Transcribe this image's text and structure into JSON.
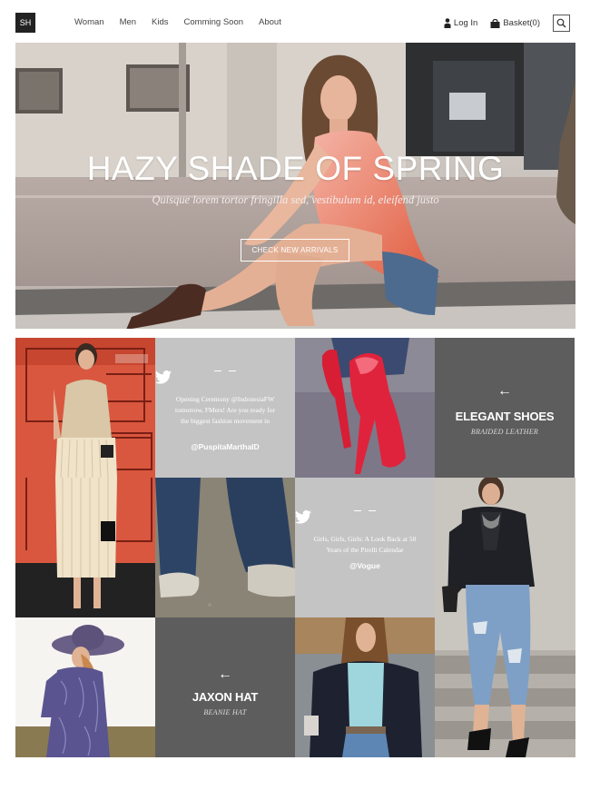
{
  "header": {
    "logo": "SH",
    "nav": [
      "Woman",
      "Men",
      "Kids",
      "Comming Soon",
      "About"
    ],
    "login_label": "Log In",
    "basket_label": "Basket(0)"
  },
  "hero": {
    "title": "HAZY SHADE OF SPRING",
    "subtitle": "Quisque lorem tortor fringilla sed, vestibulum id, eleifend justo",
    "button_label": "CHECK NEW ARRIVALS"
  },
  "tiles": {
    "tweet1": {
      "text": "Opening Ceremony @IndonesiaFW tomorrow, FMers! Are you ready for the biggest fashion movement in",
      "handle": "@PuspitaMarthaID"
    },
    "promo1": {
      "title": "ELEGANT SHOES",
      "subtitle": "BRAIDED LEATHER"
    },
    "tweet2": {
      "text": "Girls, Girls, Girls: A Look Back at 50 Years of the Pirelli Calendar",
      "handle": "@Vogue"
    },
    "promo2": {
      "title": "JAXON HAT",
      "subtitle": "BEANIE HAT"
    }
  },
  "icons": [
    "person-icon",
    "basket-icon",
    "search-icon",
    "twitter-bird-icon",
    "arrow-left-icon"
  ],
  "colors": {
    "tweet_tile": "#c4c4c4",
    "promo_tile": "#5d5d5d",
    "logo_bg": "#222222"
  }
}
